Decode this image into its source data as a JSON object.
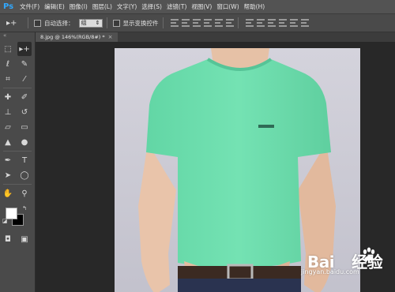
{
  "app": {
    "logo_text": "Ps"
  },
  "menu": {
    "items": [
      "文件(F)",
      "编辑(E)",
      "图像(I)",
      "图层(L)",
      "文字(Y)",
      "选择(S)",
      "滤镜(T)",
      "视图(V)",
      "窗口(W)",
      "帮助(H)"
    ]
  },
  "options_bar": {
    "tool_icon": "move-tool-icon",
    "auto_select_label": "自动选择：",
    "auto_select_value": "组",
    "show_transform_label": "显示变换控件"
  },
  "document": {
    "tab_title": "8.jpg @ 146%(RGB/8#) *",
    "close_symbol": "×"
  },
  "colors": {
    "foreground": "#ffffff",
    "background": "#000000",
    "shirt": "#6fe0b0"
  },
  "watermark": {
    "brand": "Bai",
    "brand_suffix": "经验",
    "url": "jingyan.baidu.com"
  }
}
